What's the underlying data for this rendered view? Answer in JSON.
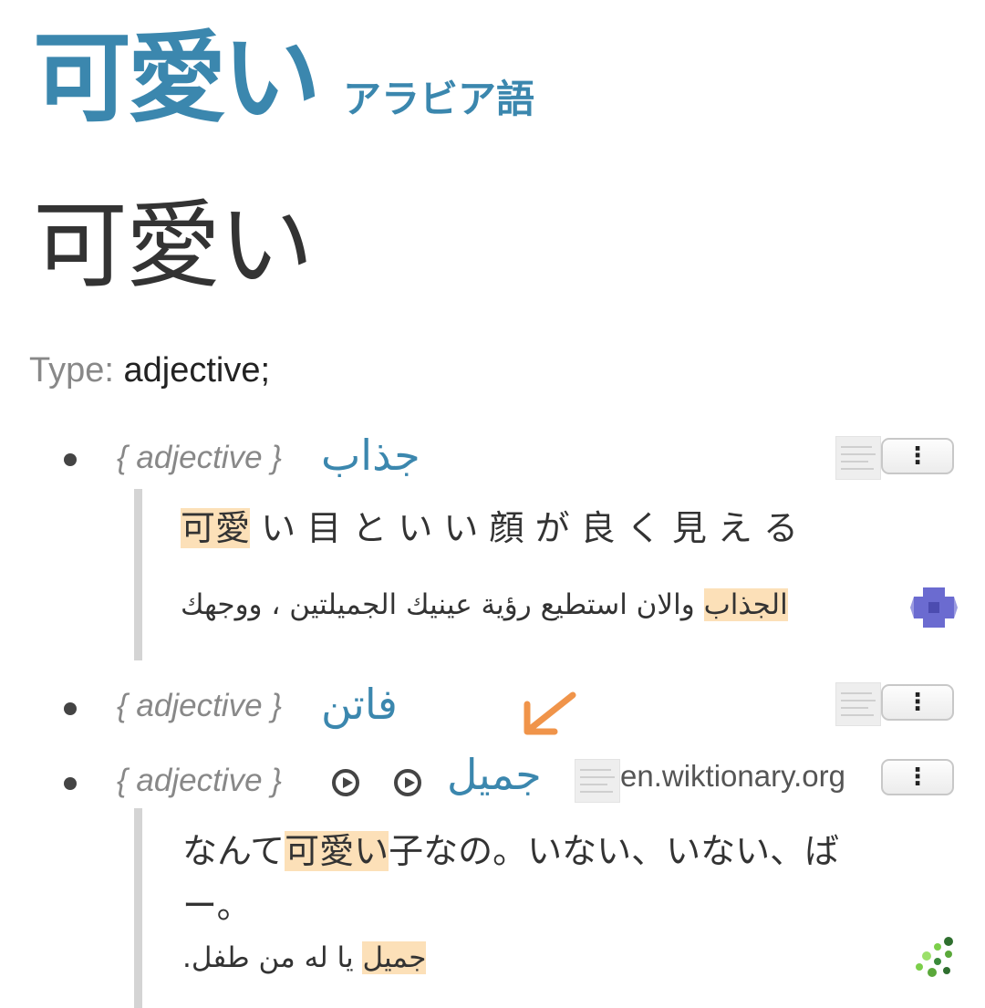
{
  "header": {
    "word": "可愛い",
    "language": "アラビア語"
  },
  "headword": "可愛い",
  "type_line": {
    "key": "Type:",
    "value": "adjective;"
  },
  "entries": [
    {
      "pos": "{ adjective }",
      "translation": "جذاب",
      "menu_icon": "vertical-dots",
      "example": {
        "jp_highlight": "可愛",
        "jp_rest": "い 目 と い い 顔 が 良 く 見 え る",
        "ar_highlight": "الجذاب",
        "ar_rest": "والان استطيع رؤية عينيك الجميلتين ، ووجهك"
      }
    },
    {
      "pos": "{ adjective }",
      "translation": "فاتن",
      "menu_icon": "vertical-dots"
    },
    {
      "pos": "{ adjective }",
      "translation": "جميل",
      "source": "en.wiktionary.org",
      "menu_icon": "vertical-dots",
      "example": {
        "jp_before": "なんて",
        "jp_highlight": "可愛い",
        "jp_after_line1": "子なの。いない、いない、ば",
        "jp_line2": "ー。",
        "ar_pre": "يا له من طفل",
        "ar_highlight": "جميل",
        "ar_post": "."
      }
    }
  ],
  "colors": {
    "accent": "#3b87ae",
    "highlight": "#fce0b8",
    "arrow": "#f0944a"
  }
}
